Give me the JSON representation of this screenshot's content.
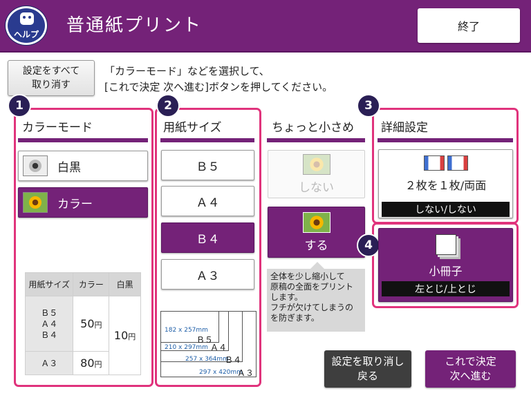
{
  "header": {
    "help_label": "ヘルプ",
    "title": "普通紙プリント",
    "exit_label": "終了"
  },
  "reset_all_label": "設定をすべて\n取り消す",
  "instruction": "「カラーモード」などを選択して、\n[これで決定 次へ進む]ボタンを押してください。",
  "sections": {
    "color_mode": {
      "number": "1",
      "title": "カラーモード",
      "options": [
        {
          "label": "白黒",
          "selected": false
        },
        {
          "label": "カラー",
          "selected": true
        }
      ]
    },
    "paper_size": {
      "number": "2",
      "title": "用紙サイズ",
      "options": [
        {
          "label": "Ｂ５",
          "selected": false
        },
        {
          "label": "Ａ４",
          "selected": false
        },
        {
          "label": "Ｂ４",
          "selected": true
        },
        {
          "label": "Ａ３",
          "selected": false
        }
      ]
    },
    "shrink": {
      "title": "ちょっと小さめ",
      "options": [
        {
          "label": "しない",
          "selected": false,
          "disabled": true
        },
        {
          "label": "する",
          "selected": true
        }
      ],
      "tooltip": "全体を少し縮小して\n原稿の全面をプリント\nします。\nフチが欠けてしまうの\nを防ぎます。"
    },
    "detail": {
      "number": "3",
      "title": "詳細設定",
      "main_label": "２枚を１枚/両面",
      "value": "しない/しない"
    },
    "booklet": {
      "number": "4",
      "main_label": "小冊子",
      "value": "左とじ/上とじ"
    }
  },
  "price_table": {
    "headers": [
      "用紙サイズ",
      "カラー",
      "白黒"
    ],
    "row1_sizes": "Ｂ５\nＡ４\nＢ４",
    "row1_color": "50",
    "row2_size": "Ａ３",
    "row2_color": "80",
    "bw_price": "10",
    "unit": "円"
  },
  "paper_diagram": {
    "b5_dims": "182 x 257mm",
    "b5_name": "Ｂ５",
    "a4_dims": "210 x 297mm",
    "a4_name": "Ａ４",
    "b4_dims": "257 x 364mm",
    "b4_name": "Ｂ４",
    "a3_dims": "297 x 420mm",
    "a3_name": "Ａ３"
  },
  "footer": {
    "back_label": "設定を取り消し\n戻る",
    "next_label": "これで決定\n次へ進む"
  },
  "colors": {
    "brand_purple": "#742278",
    "highlight_pink": "#e0337c",
    "badge_navy": "#2a1f55"
  }
}
